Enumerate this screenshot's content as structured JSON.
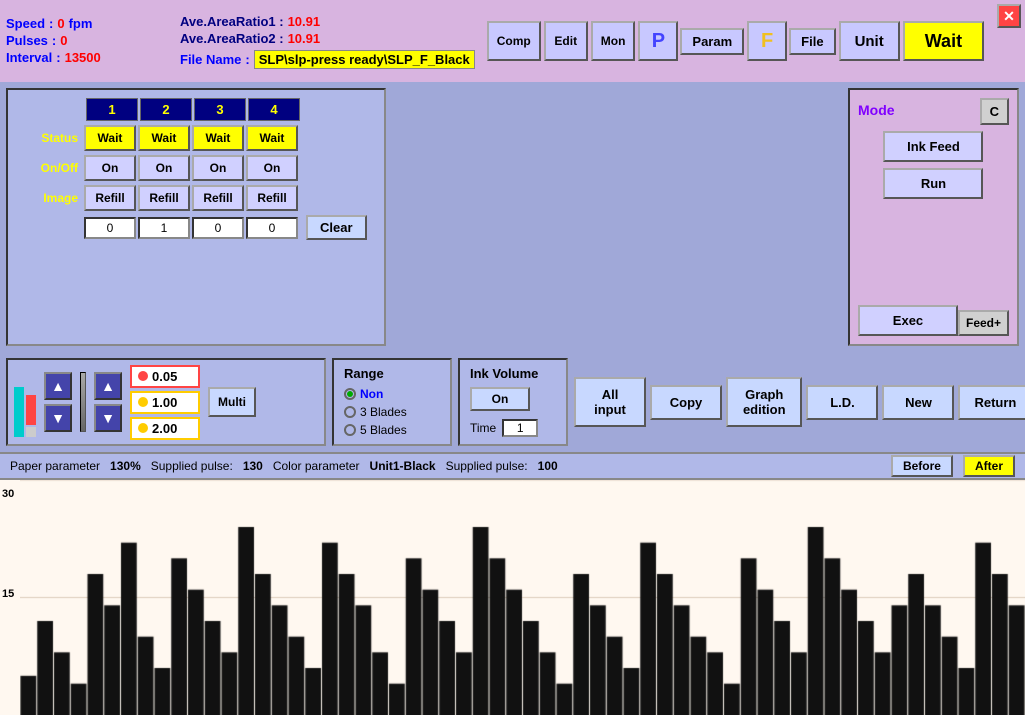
{
  "header": {
    "speed_label": "Speed",
    "speed_value": "0",
    "speed_unit": "fpm",
    "pulses_label": "Pulses",
    "pulses_value": "0",
    "interval_label": "Interval",
    "interval_value": "13500",
    "ratio1_label": "Ave.AreaRatio1 :",
    "ratio1_value": "10.91",
    "ratio2_label": "Ave.AreaRatio2 :",
    "ratio2_value": "10.91",
    "filename_label": "File Name",
    "filename_value": "SLP\\slp-press ready\\SLP_F_Black",
    "btn_comp": "Comp",
    "btn_edit": "Edit",
    "btn_mon": "Mon",
    "btn_p": "P",
    "btn_param": "Param",
    "btn_f": "F",
    "btn_file": "File",
    "btn_unit": "Unit",
    "btn_wait": "Wait",
    "btn_close": "✕"
  },
  "grid": {
    "col_headers": [
      "1",
      "2",
      "3",
      "4"
    ],
    "row_status_label": "Status",
    "row_onoff_label": "On/Off",
    "row_image_label": "Image",
    "status_cells": [
      "Wait",
      "Wait",
      "Wait",
      "Wait"
    ],
    "onoff_cells": [
      "On",
      "On",
      "On",
      "On"
    ],
    "image_cells": [
      "Refill",
      "Refill",
      "Refill",
      "Refill"
    ],
    "number_cells": [
      "0",
      "1",
      "0",
      "0"
    ],
    "clear_btn": "Clear"
  },
  "mode": {
    "title": "Mode",
    "c_btn": "C",
    "ink_feed_btn": "Ink Feed",
    "run_btn": "Run",
    "exec_btn": "Exec",
    "feed_btn": "Feed+"
  },
  "ink_controls": {
    "value1": "0.05",
    "value2": "1.00",
    "value3": "2.00",
    "multi_btn": "Multi"
  },
  "range": {
    "title": "Range",
    "options": [
      "Non",
      "3 Blades",
      "5 Blades"
    ],
    "selected": 0
  },
  "ink_volume": {
    "title": "Ink Volume",
    "on_btn": "On",
    "time_label": "Time",
    "time_value": "1"
  },
  "actions": {
    "all_input": "All input",
    "copy": "Copy",
    "graph_edition": "Graph edition",
    "ld": "L.D.",
    "new": "New",
    "return": "Return"
  },
  "status_bar": {
    "paper_param_label": "Paper parameter",
    "paper_param_value": "130%",
    "supplied_pulse_label": "Supplied pulse:",
    "supplied_pulse_value": "130",
    "color_param_label": "Color parameter",
    "color_param_value": "Unit1-Black",
    "supplied_pulse2_label": "Supplied pulse:",
    "supplied_pulse2_value": "100",
    "before_btn": "Before",
    "after_btn": "After"
  },
  "chart": {
    "label_30": "30",
    "label_15": "15",
    "bars": [
      5,
      12,
      8,
      4,
      18,
      14,
      22,
      10,
      6,
      20,
      16,
      12,
      8,
      24,
      18,
      14,
      10,
      6,
      22,
      18,
      14,
      8,
      4,
      20,
      16,
      12,
      8,
      24,
      20,
      16,
      12,
      8,
      4,
      18,
      14,
      10,
      6,
      22,
      18,
      14,
      10,
      8,
      4,
      20,
      16,
      12,
      8,
      24,
      20,
      16,
      12,
      8,
      14,
      18,
      14,
      10,
      6,
      22,
      18,
      14
    ]
  }
}
